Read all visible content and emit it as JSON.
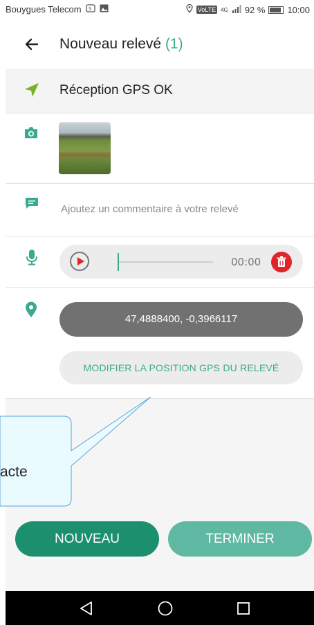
{
  "status_bar": {
    "carrier": "Bouygues Telecom",
    "network_badge": "VoLTE",
    "network_type": "4G",
    "battery": "92 %",
    "time": "10:00"
  },
  "header": {
    "title": "Nouveau relevé",
    "count": "(1)"
  },
  "gps": {
    "label": "Réception GPS OK"
  },
  "comment": {
    "placeholder": "Ajoutez un commentaire à votre relevé",
    "value": ""
  },
  "audio": {
    "time": "00:00",
    "progress": 0
  },
  "position": {
    "coordinates": "47,4888400, -0,3966117",
    "modify_label": "MODIFIER LA POSITION GPS DU RELEVÉ"
  },
  "tooltip": {
    "text": "acte"
  },
  "actions": {
    "new_label": "NOUVEAU",
    "finish_label": "TERMINER"
  },
  "colors": {
    "accent": "#3aaa8e",
    "primary_button": "#1c8f6e",
    "secondary_button": "#5fb9a2",
    "danger": "#e0242a",
    "coordinates_bg": "#717171"
  },
  "icons": {
    "back": "arrow-left",
    "gps": "navigation-arrow",
    "camera": "camera",
    "comment": "chat-bubble",
    "mic": "microphone",
    "play": "play-circle",
    "delete": "trash",
    "pin": "map-pin"
  }
}
